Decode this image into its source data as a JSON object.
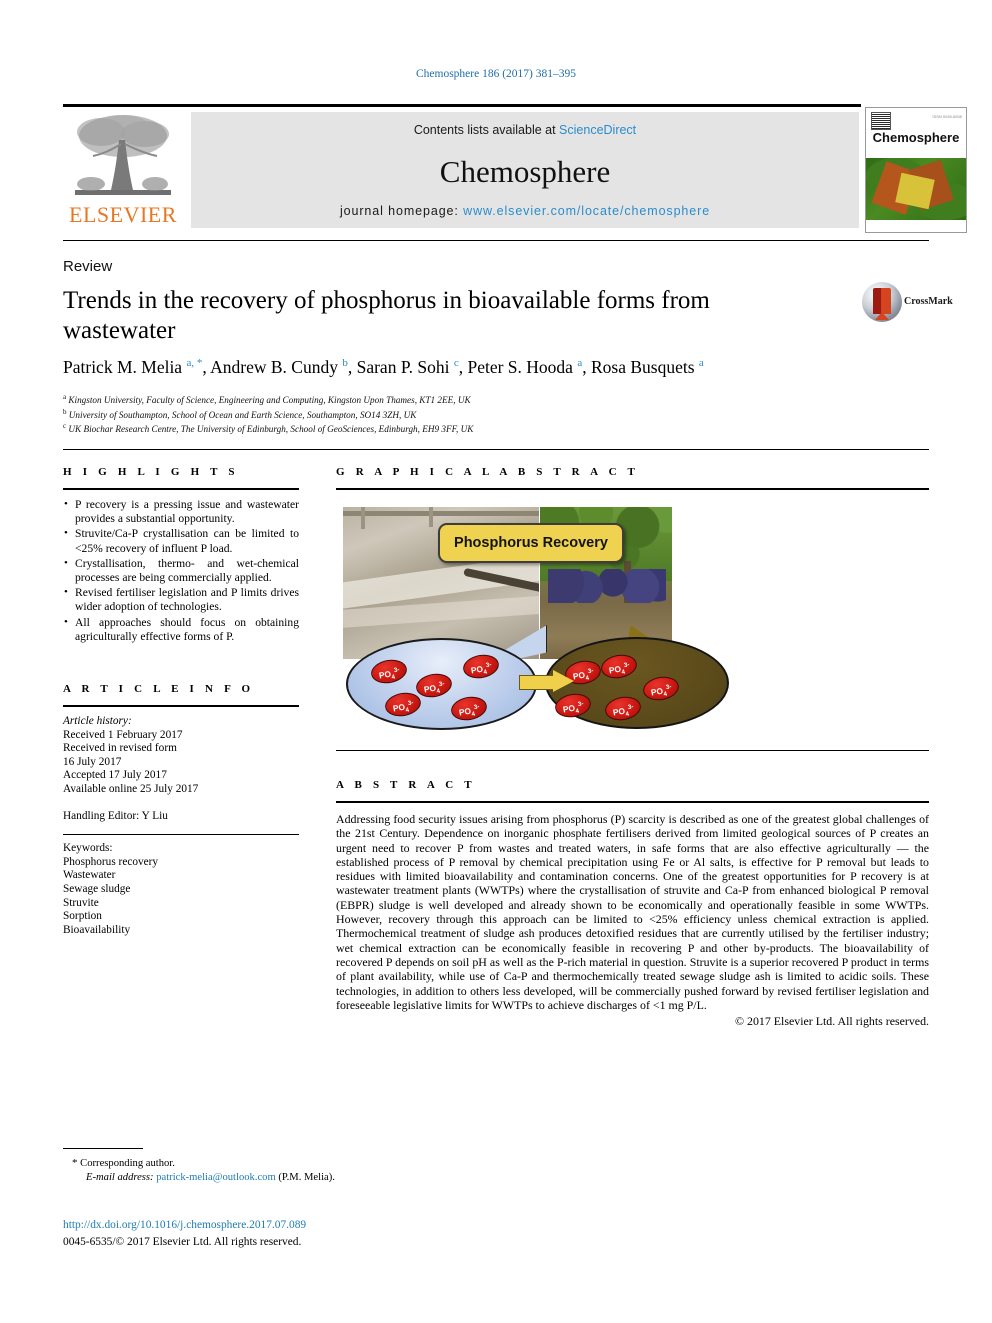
{
  "running_head": "Chemosphere 186 (2017) 381–395",
  "masthead": {
    "publisher": "ELSEVIER",
    "contents_prefix": "Contents lists available at ",
    "contents_link": "ScienceDirect",
    "journal_title": "Chemosphere",
    "homepage_prefix": "journal homepage: ",
    "homepage_url": "www.elsevier.com/locate/chemosphere",
    "cover_journal_name": "Chemosphere",
    "cover_corner_text": "ISSN 0045-6535"
  },
  "article": {
    "doc_type": "Review",
    "title": "Trends in the recovery of phosphorus in bioavailable forms from wastewater",
    "crossmark_label": "CrossMark",
    "authors": "Patrick M. Melia <sup>a, *</sup>, Andrew B. Cundy <sup>b</sup>, Saran P. Sohi <sup>c</sup>, Peter S. Hooda <sup>a</sup>, Rosa Busquets <sup>a</sup>",
    "affiliations": [
      "<sup>a</sup> Kingston University, Faculty of Science, Engineering and Computing, Kingston Upon Thames, KT1 2EE, UK",
      "<sup>b</sup> University of Southampton, School of Ocean and Earth Science, Southampton, SO14 3ZH, UK",
      "<sup>c</sup> UK Biochar Research Centre, The University of Edinburgh, School of GeoSciences, Edinburgh, EH9 3FF, UK"
    ]
  },
  "highlights": {
    "heading": "H I G H L I G H T S",
    "items": [
      "P recovery is a pressing issue and wastewater provides a substantial opportunity.",
      "Struvite/Ca-P crystallisation can be limited to <25% recovery of influent P load.",
      "Crystallisation, thermo- and wet-chemical processes are being commercially applied.",
      "Revised fertiliser legislation and P limits drives wider adoption of technologies.",
      "All approaches should focus on obtaining agriculturally effective forms of P."
    ]
  },
  "article_info": {
    "heading": "A R T I C L E   I N F O",
    "history_label": "Article history:",
    "history_lines": [
      "Received 1 February 2017",
      "Received in revised form",
      "16 July 2017",
      "Accepted 17 July 2017",
      "Available online 25 July 2017"
    ],
    "handling_editor": "Handling Editor: Y Liu",
    "keywords_label": "Keywords:",
    "keywords": [
      "Phosphorus recovery",
      "Wastewater",
      "Sewage sludge",
      "Struvite",
      "Sorption",
      "Bioavailability"
    ]
  },
  "graphical_abstract": {
    "heading": "G R A P H I C A L   A B S T R A C T",
    "banner_label": "Phosphorus Recovery",
    "left_scene": "wastewater-treatment-basin-photo",
    "right_scene": "vineyard-crop-photo",
    "left_ellipse_label": "wastewater-pool",
    "right_ellipse_label": "soil-pool",
    "ion_label_html": "PO<sub>4</sub><sup>3-</sup>",
    "ion_count_left": 5,
    "ion_count_right": 5,
    "colors": {
      "banner": "#efd24f",
      "ion": "#cc1912",
      "water_ellipse": "#9cb6e0",
      "soil_ellipse": "#5d4c1b",
      "arrow": "#f0d04a"
    }
  },
  "abstract": {
    "heading": "A B S T R A C T",
    "text": "Addressing food security issues arising from phosphorus (P) scarcity is described as one of the greatest global challenges of the 21st Century. Dependence on inorganic phosphate fertilisers derived from limited geological sources of P creates an urgent need to recover P from wastes and treated waters, in safe forms that are also effective agriculturally — the established process of P removal by chemical precipitation using Fe or Al salts, is effective for P removal but leads to residues with limited bioavailability and contamination concerns. One of the greatest opportunities for P recovery is at wastewater treatment plants (WWTPs) where the crystallisation of struvite and Ca-P from enhanced biological P removal (EBPR) sludge is well developed and already shown to be economically and operationally feasible in some WWTPs. However, recovery through this approach can be limited to <25% efficiency unless chemical extraction is applied. Thermochemical treatment of sludge ash produces detoxified residues that are currently utilised by the fertiliser industry; wet chemical extraction can be economically feasible in recovering P and other by-products. The bioavailability of recovered P depends on soil pH as well as the P-rich material in question. Struvite is a superior recovered P product in terms of plant availability, while use of Ca-P and thermochemically treated sewage sludge ash is limited to acidic soils. These technologies, in addition to others less developed, will be commercially pushed forward by revised fertiliser legislation and foreseeable legislative limits for WWTPs to achieve discharges of <1 mg P/L.",
    "copyright": "© 2017 Elsevier Ltd. All rights reserved."
  },
  "footer": {
    "corresponding_marker": "*",
    "corresponding_label": "Corresponding author.",
    "email_label": "E-mail address:",
    "email": "patrick-melia@outlook.com",
    "email_attrib": "(P.M. Melia).",
    "doi": "http://dx.doi.org/10.1016/j.chemosphere.2017.07.089",
    "issn_line": "0045-6535/© 2017 Elsevier Ltd. All rights reserved."
  }
}
